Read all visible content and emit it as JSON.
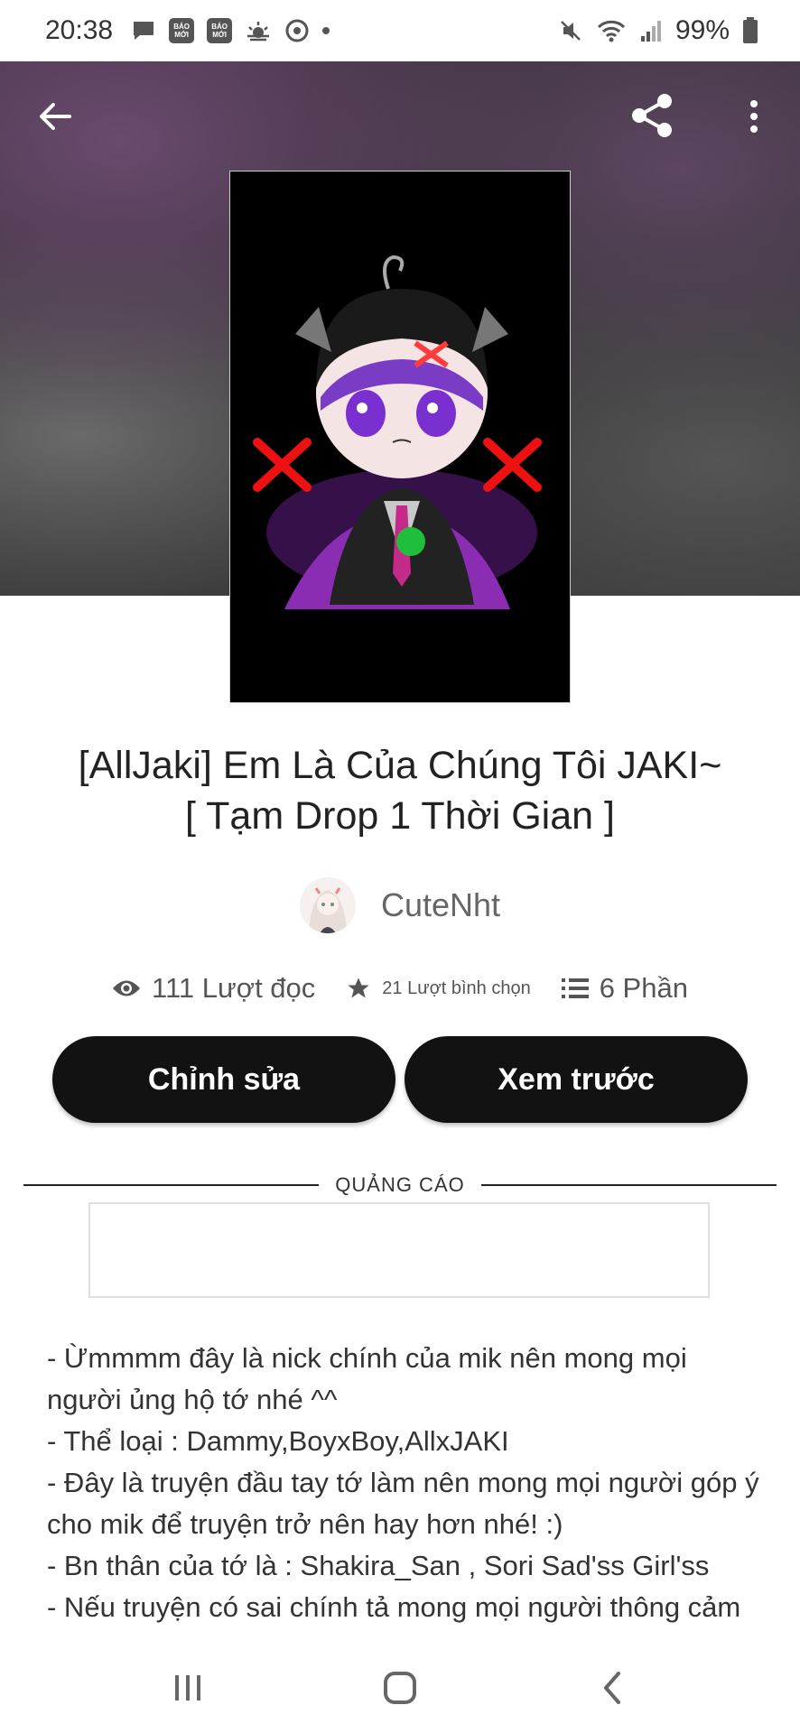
{
  "status_bar": {
    "time": "20:38",
    "notification_icons": [
      "message-icon",
      "bao-moi-icon",
      "bao-moi-icon",
      "weather-icon",
      "app-icon",
      "dot-icon"
    ],
    "bao_moi_text": "BÁO MỚI",
    "battery": "99%",
    "system_icons": [
      "mute-icon",
      "wifi-icon",
      "signal-icon",
      "battery-icon"
    ]
  },
  "header": {
    "back_icon": "arrow-left-icon",
    "share_icon": "share-icon",
    "more_icon": "more-vertical-icon"
  },
  "story": {
    "title_line1": "[AllJaki] Em Là Của Chúng Tôi JAKI~",
    "title_line2": "[ Tạm Drop 1 Thời Gian ]",
    "author": "CuteNht",
    "reads": "111 Lượt đọc",
    "votes": "21 Lượt bình chọn",
    "parts": "6 Phần"
  },
  "actions": {
    "edit_label": "Chỉnh sửa",
    "preview_label": "Xem trước"
  },
  "ad": {
    "label": "QUẢNG CÁO"
  },
  "description": {
    "lines": [
      "- Ừmmmm đây là nick chính của mik nên mong mọi người ủng hộ tớ nhé ^^",
      "- Thể loại : Dammy,BoyxBoy,AllxJAKI",
      "- Đây là truyện đầu tay tớ làm nên mong mọi người góp ý cho mik để truyện trở nên hay hơn nhé! :)",
      "- Bn thân của tớ là : Shakira_San , Sori Sad'ss Girl'ss",
      "- Nếu truyện có sai chính tả mong mọi người thông cảm"
    ]
  },
  "nav": {
    "recents_icon": "recents-icon",
    "home_icon": "home-icon",
    "back_icon": "nav-back-icon"
  }
}
